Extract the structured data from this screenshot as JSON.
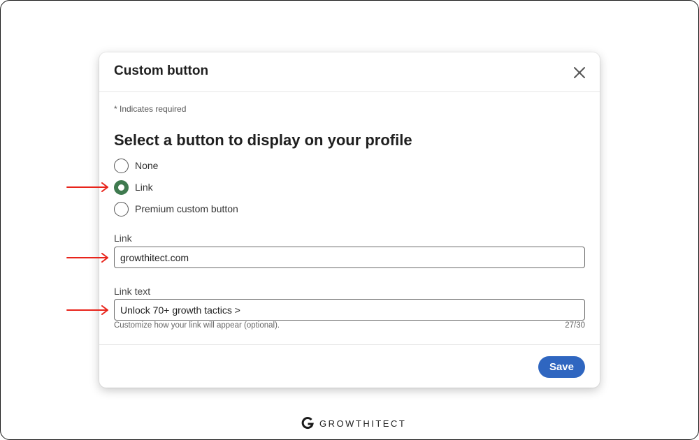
{
  "modal": {
    "title": "Custom button",
    "required_note": "* Indicates required",
    "heading": "Select a button to display on your profile",
    "options": [
      {
        "label": "None",
        "checked": false
      },
      {
        "label": "Link",
        "checked": true
      },
      {
        "label": "Premium custom button",
        "checked": false
      }
    ],
    "link_field": {
      "label": "Link",
      "value": "growthitect.com"
    },
    "link_text_field": {
      "label": "Link text",
      "value": "Unlock 70+ growth tactics >",
      "helper": "Customize how your link will appear (optional).",
      "counter": "27/30"
    },
    "save_label": "Save"
  },
  "colors": {
    "accent": "#2f66c0",
    "radio_checked": "#3f7a4f",
    "annotation_arrow": "#e8241b"
  },
  "brand": {
    "name": "GROWTHITECT"
  }
}
